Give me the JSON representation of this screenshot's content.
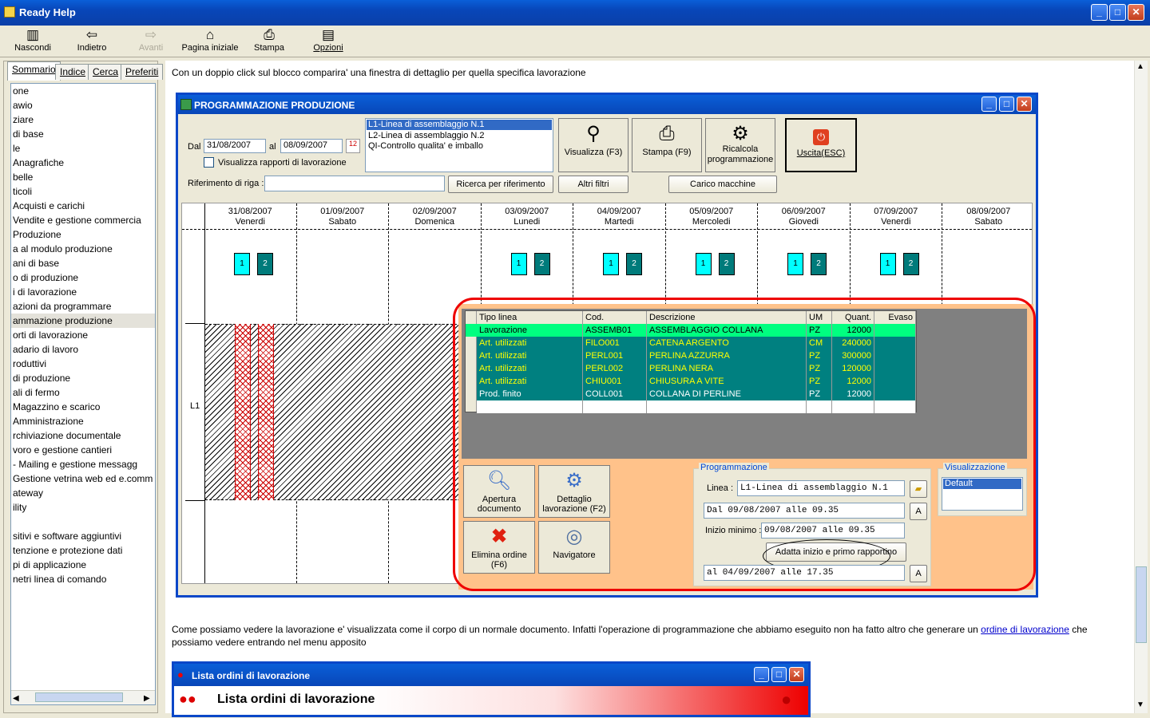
{
  "app": {
    "title": "Ready Help"
  },
  "toolbar": {
    "hide": "Nascondi",
    "back": "Indietro",
    "forward": "Avanti",
    "home": "Pagina iniziale",
    "print": "Stampa",
    "options": "Opzioni"
  },
  "tabs": {
    "contents": "Sommario",
    "index": "Indice",
    "search": "Cerca",
    "favorites": "Preferiti"
  },
  "tree": [
    "one",
    "awio",
    "ziare",
    "di base",
    "le",
    "Anagrafiche",
    "belle",
    "ticoli",
    "Acquisti e carichi",
    "Vendite e gestione commercia",
    "Produzione",
    "a al modulo produzione",
    "ani di base",
    "o di produzione",
    "i di lavorazione",
    "azioni da programmare",
    "ammazione produzione",
    "orti di lavorazione",
    "adario di lavoro",
    "roduttivi",
    "di produzione",
    "ali di fermo",
    "Magazzino e scarico",
    "Amministrazione",
    "rchiviazione documentale",
    "voro e gestione cantieri",
    "- Mailing e gestione messagg",
    "Gestione vetrina web ed e.comm",
    "ateway",
    "ility",
    "",
    "sitivi e software aggiuntivi",
    "tenzione e protezione dati",
    "pi di applicazione",
    "netri linea di comando"
  ],
  "content": {
    "intro": "Con un doppio click sul blocco comparira' una finestra di dettaglio per quella specifica lavorazione",
    "para_before": "Come possiamo vedere la lavorazione e' visualizzata come il corpo di un normale documento. Infatti l'operazione di programmazione che abbiamo eseguito non ha fatto altro che generare un ",
    "para_link": "ordine di lavorazione",
    "para_after": " che possiamo vedere entrando nel menu apposito"
  },
  "prog": {
    "title": "PROGRAMMAZIONE PRODUZIONE",
    "dal_label": "Dal",
    "dal": "31/08/2007",
    "al_label": "al",
    "al": "08/09/2007",
    "show_reports": "Visualizza rapporti di lavorazione",
    "ref_label": "Riferimento di riga :",
    "search_ref": "Ricerca per riferimento",
    "other_filters": "Altri filtri",
    "machine_load": "Carico macchine",
    "lines": [
      "L1-Linea di assemblaggio N.1",
      "L2-Linea di assemblaggio N.2",
      "QI-Controllo qualita' e imballo"
    ],
    "btn_view": "Visualizza (F3)",
    "btn_print": "Stampa (F9)",
    "btn_recalc1": "Ricalcola",
    "btn_recalc2": "programmazione",
    "btn_exit": "Uscita(ESC)",
    "days": [
      [
        "31/08/2007",
        "Venerdi"
      ],
      [
        "01/09/2007",
        "Sabato"
      ],
      [
        "02/09/2007",
        "Domenica"
      ],
      [
        "03/09/2007",
        "Lunedi"
      ],
      [
        "04/09/2007",
        "Martedi"
      ],
      [
        "05/09/2007",
        "Mercoledi"
      ],
      [
        "06/09/2007",
        "Giovedi"
      ],
      [
        "07/09/2007",
        "Venerdi"
      ],
      [
        "08/09/2007",
        "Sabato"
      ]
    ],
    "row_label": "L1",
    "block1": "1",
    "block2": "2"
  },
  "detail": {
    "headers": [
      "Tipo linea",
      "Cod.",
      "Descrizione",
      "UM",
      "Quant.",
      "Evaso"
    ],
    "rows": [
      [
        "Lavorazione",
        "ASSEMB01",
        "ASSEMBLAGGIO COLLANA",
        "PZ",
        "12000",
        ""
      ],
      [
        "Art. utilizzati",
        "FILO001",
        "CATENA ARGENTO",
        "CM",
        "240000",
        ""
      ],
      [
        "Art. utilizzati",
        "PERL001",
        "PERLINA AZZURRA",
        "PZ",
        "300000",
        ""
      ],
      [
        "Art. utilizzati",
        "PERL002",
        "PERLINA NERA",
        "PZ",
        "120000",
        ""
      ],
      [
        "Art. utilizzati",
        "CHIU001",
        "CHIUSURA A VITE",
        "PZ",
        "12000",
        ""
      ],
      [
        "Prod. finito",
        "COLL001",
        "COLLANA DI PERLINE",
        "PZ",
        "12000",
        ""
      ]
    ],
    "btn_open1": "Apertura",
    "btn_open2": "documento",
    "btn_detail1": "Dettaglio",
    "btn_detail2": "lavorazione (F2)",
    "btn_delete1": "Elimina ordine",
    "btn_delete2": "(F6)",
    "btn_nav": "Navigatore",
    "prog_group": "Programmazione",
    "linea_label": "Linea :",
    "linea": "L1-Linea di assemblaggio N.1",
    "dal_text": "Dal 09/08/2007 alle 09.35",
    "a_btn": "A",
    "inizio_label": "Inizio minimo :",
    "inizio": "09/08/2007 alle 09.35",
    "adapt_btn": "Adatta inizio e primo rapportino",
    "al_text": "al 04/09/2007 alle 17.35",
    "vis_group": "Visualizzazione",
    "vis_default": "Default"
  },
  "lista": {
    "title": "Lista ordini di lavorazione",
    "header": "Lista ordini di lavorazione"
  }
}
